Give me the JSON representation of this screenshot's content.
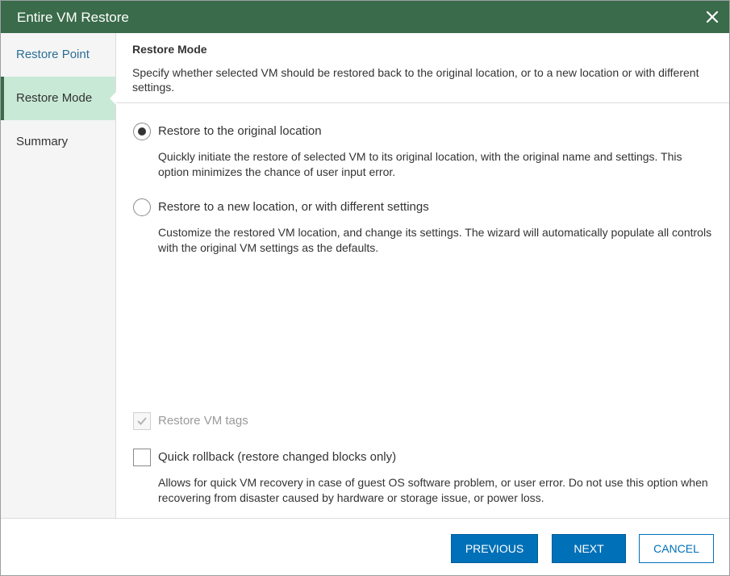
{
  "window": {
    "title": "Entire VM Restore",
    "close_icon": "close-icon",
    "titlebar_color": "#3a6b4a"
  },
  "sidebar": {
    "items": [
      {
        "label": "Restore Point",
        "state": "link"
      },
      {
        "label": "Restore Mode",
        "state": "active"
      },
      {
        "label": "Summary",
        "state": "plain"
      }
    ]
  },
  "header": {
    "title": "Restore Mode",
    "description": "Specify whether selected VM should be restored back to the original location, or to a new location or with different settings."
  },
  "options": [
    {
      "label": "Restore to the original location",
      "description": "Quickly initiate the restore of selected VM to its original location, with the original name and settings. This option minimizes the chance of user input error.",
      "selected": true
    },
    {
      "label": "Restore to a new location, or with different settings",
      "description": "Customize the restored VM location, and change its settings. The wizard will automatically populate all controls with the original VM settings as the defaults.",
      "selected": false
    }
  ],
  "checkboxes": {
    "restore_tags": {
      "label": "Restore VM tags",
      "checked": true,
      "disabled": true
    },
    "quick_rollback": {
      "label": "Quick rollback (restore changed blocks only)",
      "checked": false,
      "disabled": false,
      "description": "Allows for quick VM recovery in case of guest OS software problem, or user error. Do not use this option when recovering from disaster caused by hardware or storage issue, or power loss."
    }
  },
  "footer": {
    "previous_label": "PREVIOUS",
    "next_label": "NEXT",
    "cancel_label": "CANCEL",
    "primary_color": "#0070b8"
  }
}
